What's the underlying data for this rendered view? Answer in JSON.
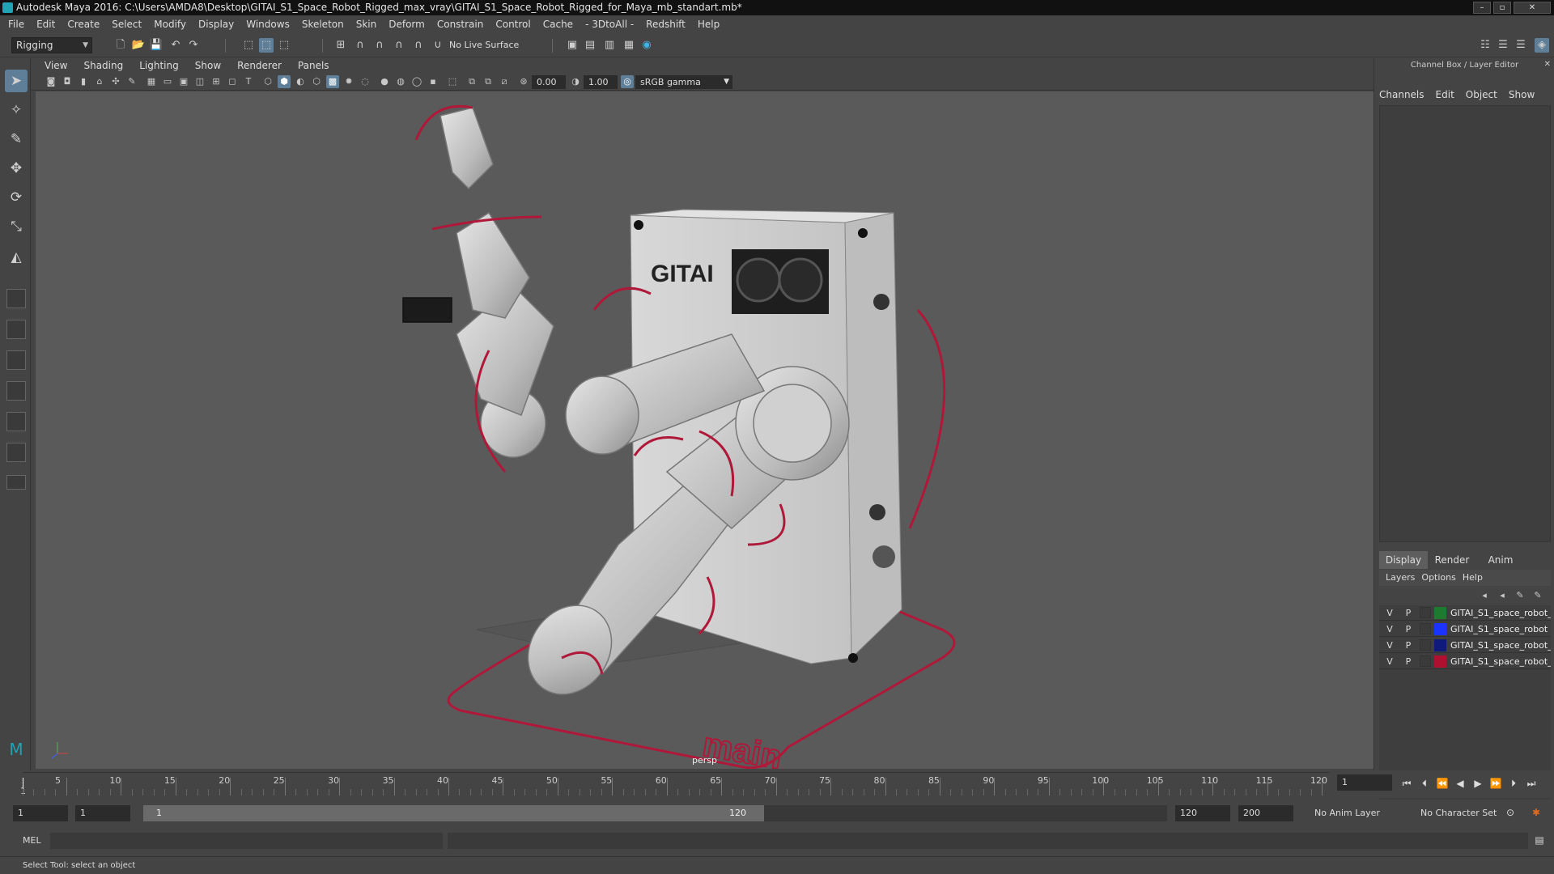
{
  "window": {
    "title": "Autodesk Maya 2016: C:\\Users\\AMDA8\\Desktop\\GITAI_S1_Space_Robot_Rigged_max_vray\\GITAI_S1_Space_Robot_Rigged_for_Maya_mb_standart.mb*",
    "minimize": "–",
    "maximize": "▫",
    "close": "✕"
  },
  "menubar": [
    "File",
    "Edit",
    "Create",
    "Select",
    "Modify",
    "Display",
    "Windows",
    "Skeleton",
    "Skin",
    "Deform",
    "Constrain",
    "Control",
    "Cache",
    "- 3DtoAll -",
    "Redshift",
    "Help"
  ],
  "shelf": {
    "mode": "Rigging",
    "live_surface": "No Live Surface"
  },
  "viewport": {
    "menus": [
      "View",
      "Shading",
      "Lighting",
      "Show",
      "Renderer",
      "Panels"
    ],
    "exposure": "0.00",
    "gamma": "1.00",
    "colorspace": "sRGB gamma",
    "camera_label": "persp",
    "ground_text": "main",
    "logo_text": "GITAI",
    "accent_color": "#b0183a"
  },
  "right_panel": {
    "title": "Channel Box / Layer Editor",
    "cb_tabs": [
      "Channels",
      "Edit",
      "Object",
      "Show"
    ],
    "le_tabs": [
      "Display",
      "Render",
      "Anim"
    ],
    "le_menu": [
      "Layers",
      "Options",
      "Help"
    ],
    "layers": [
      {
        "v": "V",
        "p": "P",
        "color": "#1e7a2e",
        "name": "GITAI_S1_space_robot_"
      },
      {
        "v": "V",
        "p": "P",
        "color": "#1a33ff",
        "name": "GITAI_S1_space_robot"
      },
      {
        "v": "V",
        "p": "P",
        "color": "#101a7a",
        "name": "GITAI_S1_space_robot_"
      },
      {
        "v": "V",
        "p": "P",
        "color": "#b01030",
        "name": "GITAI_S1_space_robot_"
      }
    ]
  },
  "timeline": {
    "ticks": [
      "5",
      "10",
      "15",
      "20",
      "25",
      "30",
      "35",
      "40",
      "45",
      "50",
      "55",
      "60",
      "65",
      "70",
      "75",
      "80",
      "85",
      "90",
      "95",
      "100",
      "105",
      "110",
      "115",
      "120"
    ],
    "start_marker": "1",
    "current_frame": "1"
  },
  "range": {
    "start": "1",
    "anim_start": "1",
    "slider_start": "1",
    "slider_end": "120",
    "end": "120",
    "anim_end": "200",
    "anim_layer": "No Anim Layer",
    "char_set": "No Character Set"
  },
  "command": {
    "label": "MEL"
  },
  "help_line": "Select Tool: select an object"
}
